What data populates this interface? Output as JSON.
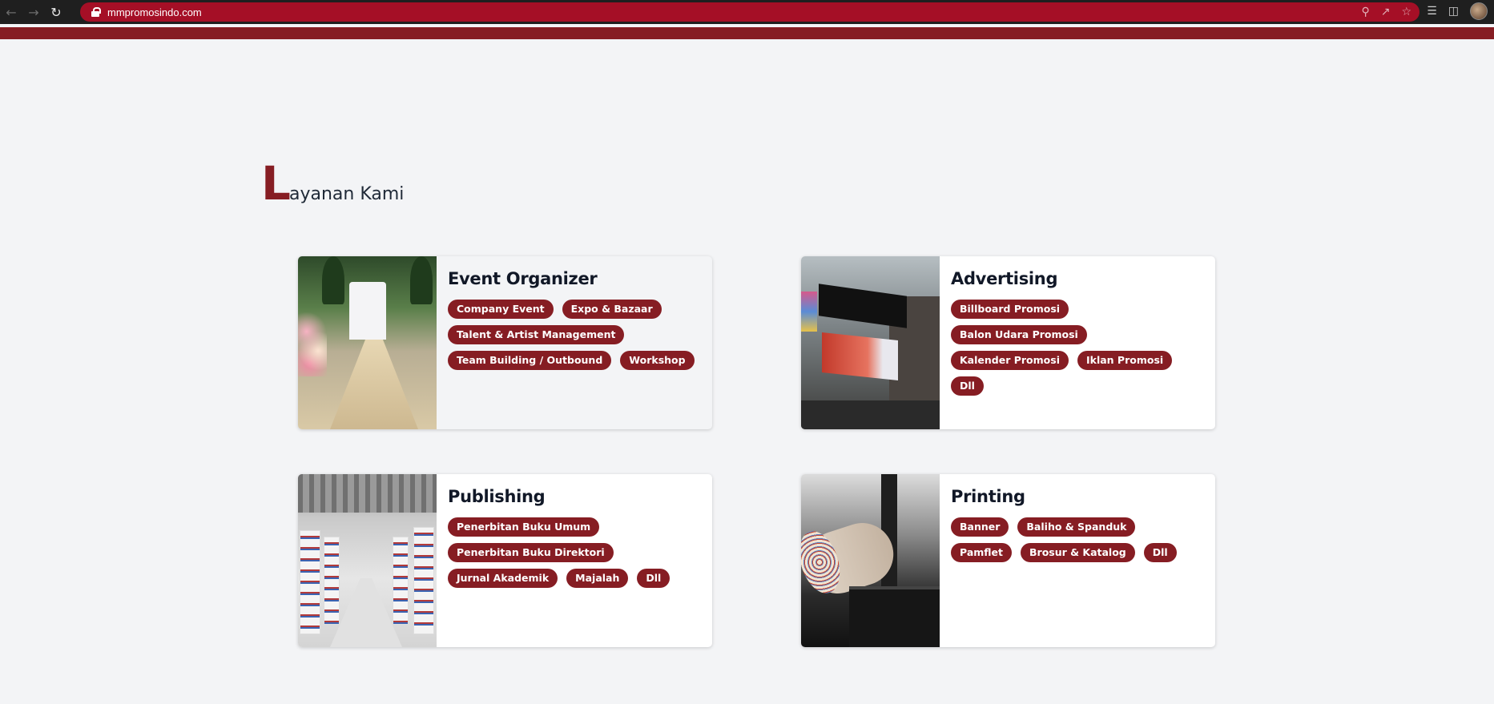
{
  "browser": {
    "url": "mmpromosindo.com",
    "back_icon": "arrow-left-icon",
    "forward_icon": "arrow-right-icon",
    "reload_icon": "reload-icon"
  },
  "section": {
    "title_first_letter": "L",
    "title_rest": "ayanan Kami"
  },
  "colors": {
    "brand": "#861d23",
    "address_bar": "#a50f26",
    "page_bg": "#f3f4f6"
  },
  "services": [
    {
      "title": "Event Organizer",
      "image_icon": "wedding-aisle-image",
      "tags": [
        "Company Event",
        "Expo & Bazaar",
        "Talent & Artist Management",
        "Team Building / Outbound",
        "Workshop"
      ]
    },
    {
      "title": "Advertising",
      "image_icon": "billboard-image",
      "tags": [
        "Billboard Promosi",
        "Balon Udara Promosi",
        "Kalender Promosi",
        "Iklan Promosi",
        "Dll"
      ]
    },
    {
      "title": "Publishing",
      "image_icon": "library-image",
      "tags": [
        "Penerbitan Buku Umum",
        "Penerbitan Buku Direktori",
        "Jurnal Akademik",
        "Majalah",
        "Dll"
      ]
    },
    {
      "title": "Printing",
      "image_icon": "printing-press-image",
      "tags": [
        "Banner",
        "Baliho & Spanduk",
        "Pamflet",
        "Brosur & Katalog",
        "Dll"
      ]
    }
  ]
}
